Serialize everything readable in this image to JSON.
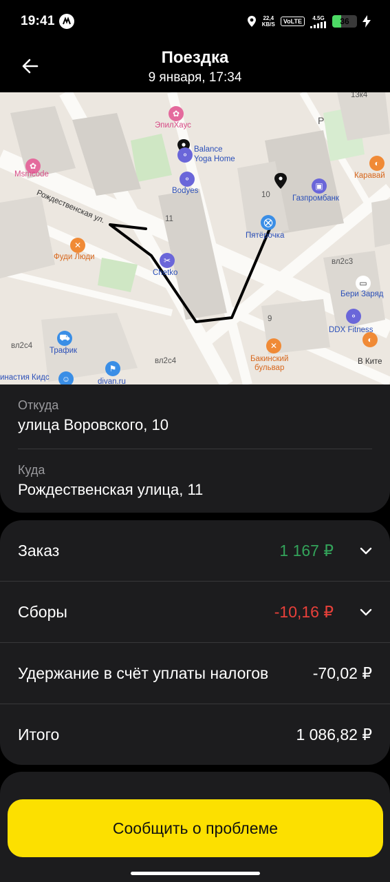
{
  "status_bar": {
    "time": "19:41",
    "net_speed_value": "22,4",
    "net_speed_unit": "KB/S",
    "volte": "VoLTE",
    "network": "4.5G",
    "battery_level": "36",
    "battery_percent": 36
  },
  "header": {
    "title": "Поездка",
    "subtitle": "9 января, 17:34"
  },
  "map": {
    "labels": {
      "epilhaus": "ЭпилХаус",
      "balance_yoga": "Balance\nYoga Home",
      "bodyes": "Bodyes",
      "msmcode": "Msmcode",
      "street_rozhd": "Рождественская ул.",
      "fudi_ludi": "Фуди Люди",
      "chetko": "Chetko",
      "pyaterochka": "Пятёрочка",
      "gazprombank": "Газпромбанк",
      "karavay": "Каравай",
      "vl2c3": "вл2с3",
      "beri_zaryad": "Бери Заряд",
      "ddx_fitness": "DDX Fitness",
      "bakinsky": "Бакинский\nбульвар",
      "v_kite": "В Ките",
      "trafik": "Трафик",
      "vl2c4_left": "вл2с4",
      "vl2c4_mid": "вл2с4",
      "dinastiya": "инастия Кидс",
      "divan": "divan.ru",
      "house_13k4": "13к4",
      "house_10": "10",
      "house_11": "11",
      "house_9": "9",
      "parking": "P"
    }
  },
  "trip": {
    "from_caption": "Откуда",
    "from_address": "улица Воровского, 10",
    "to_caption": "Куда",
    "to_address": "Рождественская улица, 11"
  },
  "payment": {
    "order_label": "Заказ",
    "order_value": "1 167 ₽",
    "fees_label": "Сборы",
    "fees_value": "-10,16 ₽",
    "tax_label": "Удержание в счёт уплаты налогов",
    "tax_value": "-70,02 ₽",
    "total_label": "Итого",
    "total_value": "1 086,82 ₽"
  },
  "actions": {
    "report_problem": "Сообщить о проблеме"
  },
  "colors": {
    "accent_yellow": "#fce000",
    "positive_green": "#33a35a",
    "negative_red": "#e8403a",
    "card_bg": "#1c1c1e"
  }
}
